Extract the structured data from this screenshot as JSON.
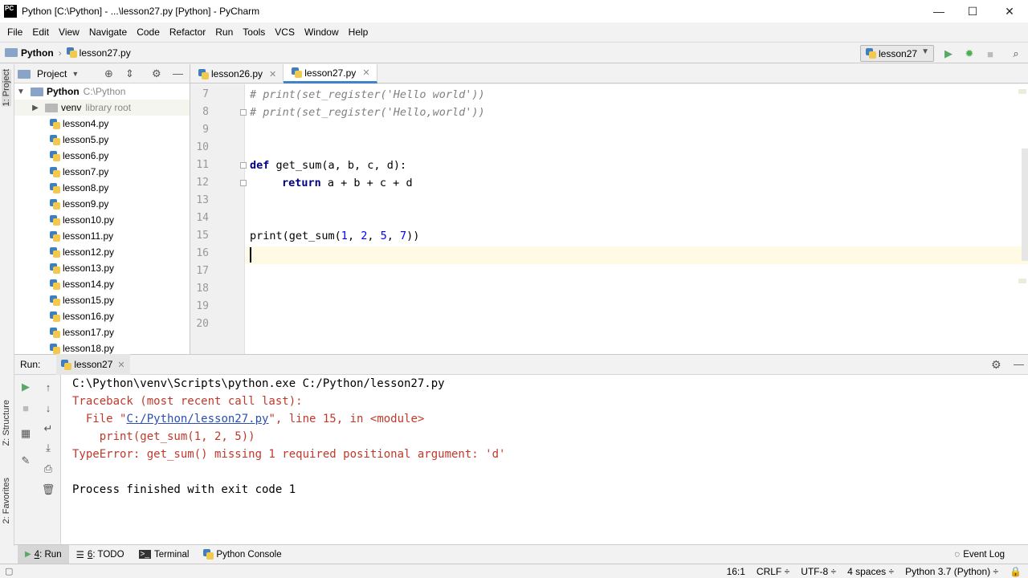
{
  "window": {
    "title": "Python [C:\\Python] - ...\\lesson27.py [Python] - PyCharm",
    "logo": "PC",
    "minimize": "—",
    "maximize": "☐",
    "close": "✕"
  },
  "menu": [
    "File",
    "Edit",
    "View",
    "Navigate",
    "Code",
    "Refactor",
    "Run",
    "Tools",
    "VCS",
    "Window",
    "Help"
  ],
  "navbar": {
    "project": "Python",
    "file": "lesson27.py",
    "run_config": "lesson27"
  },
  "left_stripe": {
    "project_label": "1: Project",
    "structure_label": "Z: Structure",
    "favorites_label": "2: Favorites"
  },
  "project_panel": {
    "title": "Project",
    "root": {
      "name": "Python",
      "path": "C:\\Python"
    },
    "venv": {
      "name": "venv",
      "note": "library root"
    },
    "files": [
      "lesson4.py",
      "lesson5.py",
      "lesson6.py",
      "lesson7.py",
      "lesson8.py",
      "lesson9.py",
      "lesson10.py",
      "lesson11.py",
      "lesson12.py",
      "lesson13.py",
      "lesson14.py",
      "lesson15.py",
      "lesson16.py",
      "lesson17.py",
      "lesson18.py"
    ]
  },
  "editor": {
    "tabs": [
      {
        "label": "lesson26.py",
        "active": false
      },
      {
        "label": "lesson27.py",
        "active": true
      }
    ],
    "line_numbers": [
      "7",
      "8",
      "9",
      "10",
      "11",
      "12",
      "13",
      "14",
      "15",
      "16",
      "17",
      "18",
      "19",
      "20"
    ],
    "code": {
      "l7": "# print(set_register('Hello world'))",
      "l8": "# print(set_register('Hello,world'))",
      "l11_kw": "def",
      "l11_rest": " get_sum(a, b, c, d):",
      "l12_kw": "return",
      "l12_rest": " a + b + c + d",
      "l15_a": "print(get_sum(",
      "l15_n1": "1",
      "l15_s1": ", ",
      "l15_n2": "2",
      "l15_s2": ", ",
      "l15_n3": "5",
      "l15_s3": ", ",
      "l15_n4": "7",
      "l15_b": "))"
    }
  },
  "run_panel": {
    "label": "Run:",
    "tab": "lesson27",
    "output": {
      "cmd": "C:\\Python\\venv\\Scripts\\python.exe C:/Python/lesson27.py",
      "traceback": "Traceback (most recent call last):",
      "file_prefix": "  File \"",
      "file_link": "C:/Python/lesson27.py",
      "file_suffix": "\", line 15, in <module>",
      "code_line": "    print(get_sum(1, 2, 5))",
      "error": "TypeError: get_sum() missing 1 required positional argument: 'd'",
      "finished": "Process finished with exit code 1"
    }
  },
  "bottom_tools": [
    {
      "key": "4",
      "label": ": Run"
    },
    {
      "key": "6",
      "label": ": TODO"
    },
    {
      "key": "",
      "label": "Terminal"
    },
    {
      "key": "",
      "label": "Python Console"
    }
  ],
  "event_log": "Event Log",
  "status": {
    "position": "16:1",
    "line_sep": "CRLF ÷",
    "encoding": "UTF-8 ÷",
    "indent": "4 spaces ÷",
    "interpreter": "Python 3.7 (Python) ÷"
  },
  "colors": {
    "run_green": "#59a869",
    "debug_green": "#4caf50",
    "caret_line": "#fffae3",
    "keyword": "#000080",
    "number": "#0000ff",
    "comment": "#808080",
    "error_red": "#c0392b"
  }
}
